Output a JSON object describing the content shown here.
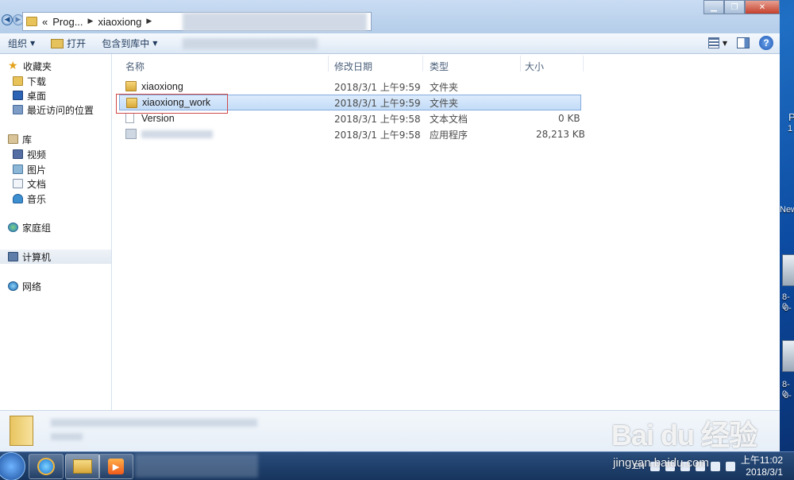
{
  "address": {
    "segments": [
      "Prog...",
      "xiaoxiong"
    ],
    "prefix": "«"
  },
  "toolbar": {
    "organize": "组织",
    "open": "打开",
    "include_library": "包含到库中"
  },
  "navpane": {
    "favorites": "收藏夹",
    "downloads": "下载",
    "desktop": "桌面",
    "recent": "最近访问的位置",
    "libraries": "库",
    "videos": "视频",
    "pictures": "图片",
    "documents": "文档",
    "music": "音乐",
    "homegroup": "家庭组",
    "computer": "计算机",
    "network": "网络"
  },
  "columns": {
    "name": "名称",
    "date": "修改日期",
    "type": "类型",
    "size": "大小"
  },
  "files": [
    {
      "name": "xiaoxiong",
      "date": "2018/3/1 上午9:59",
      "type": "文件夹",
      "size": "",
      "icon": "folder-icon"
    },
    {
      "name": "xiaoxiong_work",
      "date": "2018/3/1 上午9:59",
      "type": "文件夹",
      "size": "",
      "icon": "folder-icon"
    },
    {
      "name": "Version",
      "date": "2018/3/1 上午9:58",
      "type": "文本文档",
      "size": "0 KB",
      "icon": "text-file-icon"
    },
    {
      "name": "",
      "date": "2018/3/1 上午9:58",
      "type": "应用程序",
      "size": "28,213 KB",
      "icon": "application-icon"
    }
  ],
  "taskbar": {
    "lang": "EN",
    "time": "上午11:02",
    "date": "2018/3/1"
  },
  "desktop_text": {
    "p": "P",
    "one": "1",
    "new": "New",
    "a": "8-0",
    "b": "0-",
    "c": "8-0",
    "d": "0-"
  },
  "watermark": {
    "brand": "Bai du 经验",
    "url": "jingyan.baidu.com"
  },
  "colors": {
    "selection": "#cce4fb",
    "highlight_box": "#d04848",
    "title_blue": "#b4cde9"
  }
}
